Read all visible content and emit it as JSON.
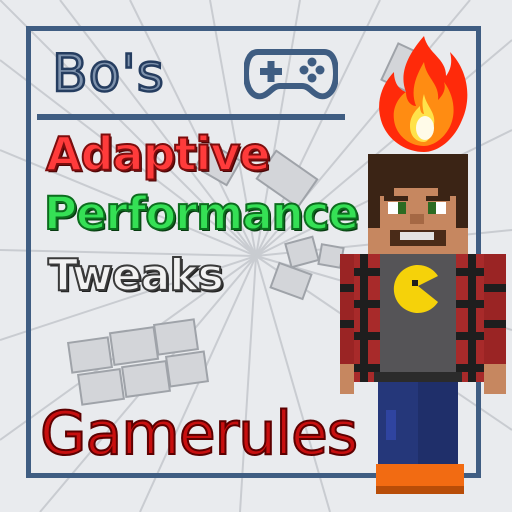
{
  "logo": {
    "owner": "Bo's",
    "icon": "gamepad-icon"
  },
  "title_lines": [
    {
      "text": "Adaptive",
      "color": "#ff3b3b"
    },
    {
      "text": "Performance",
      "color": "#35e055"
    },
    {
      "text": "Tweaks",
      "color": "#f2f2f2"
    }
  ],
  "subtitle": "Gamerules",
  "colors": {
    "frame": "#3f5d82",
    "background": "#e9ebee"
  },
  "decorations": {
    "flame_icon": "fire-icon",
    "character": "minecraft-player-character"
  }
}
